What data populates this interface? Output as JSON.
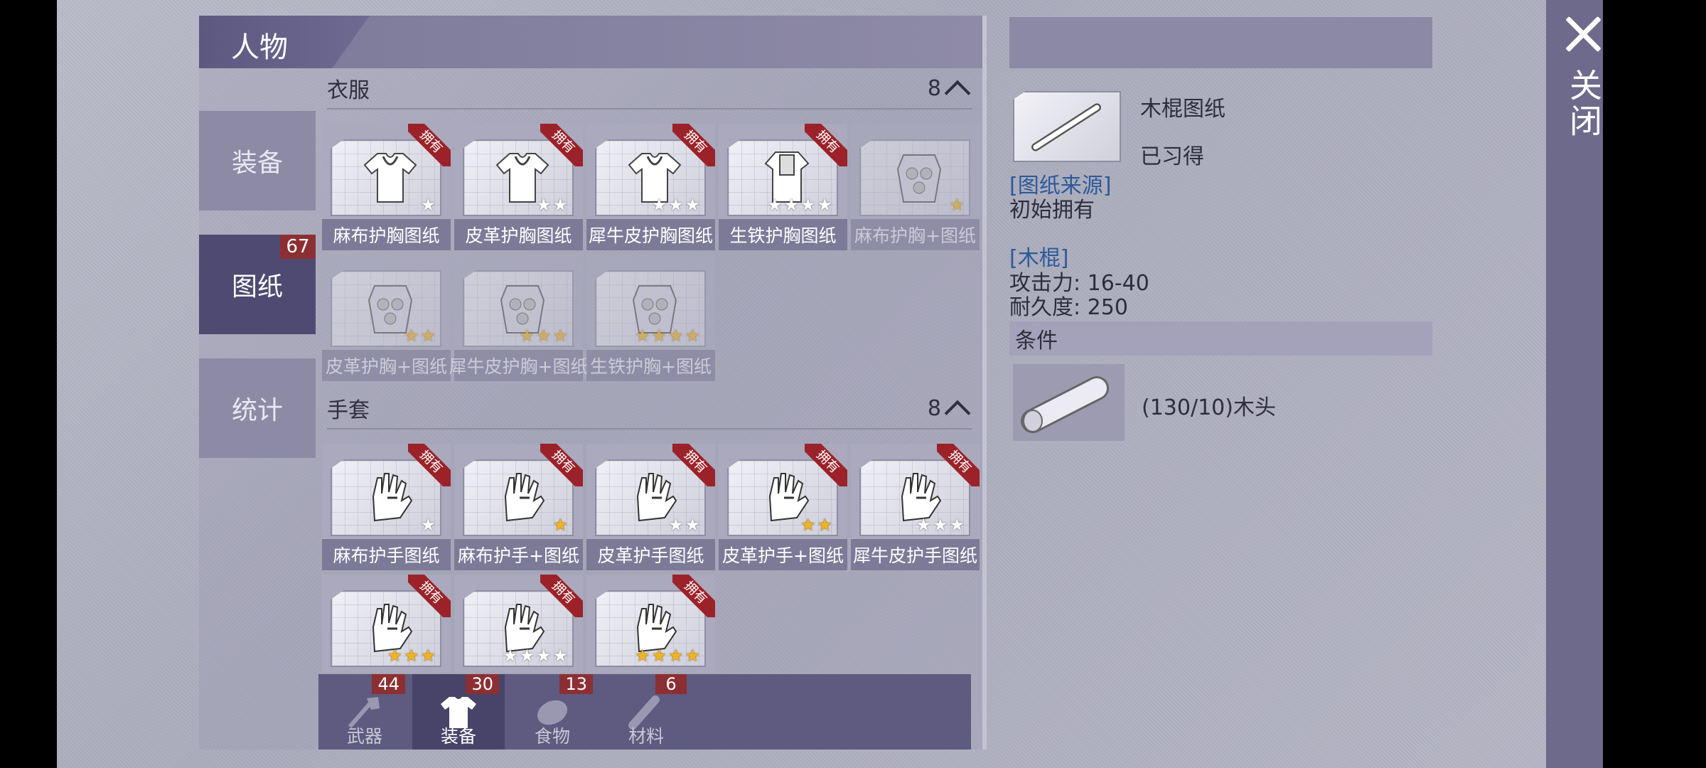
{
  "window": {
    "title": "人物",
    "close_label": "关闭"
  },
  "side_tabs": [
    {
      "label": "装备",
      "badge": ""
    },
    {
      "label": "图纸",
      "badge": "67"
    },
    {
      "label": "统计",
      "badge": ""
    }
  ],
  "sections": [
    {
      "title": "衣服",
      "count": "8",
      "items": [
        {
          "label": "麻布护胸图纸",
          "owned": true,
          "owned_label": "拥有",
          "stars": 1,
          "star_color": "white",
          "icon": "shirt-icon"
        },
        {
          "label": "皮革护胸图纸",
          "owned": true,
          "owned_label": "拥有",
          "stars": 2,
          "star_color": "white",
          "icon": "shirt-icon"
        },
        {
          "label": "犀牛皮护胸图纸",
          "owned": true,
          "owned_label": "拥有",
          "stars": 3,
          "star_color": "white",
          "icon": "shirt-icon"
        },
        {
          "label": "生铁护胸图纸",
          "owned": true,
          "owned_label": "拥有",
          "stars": 4,
          "star_color": "white",
          "icon": "vest-icon"
        },
        {
          "label": "麻布护胸+图纸",
          "owned": false,
          "owned_label": "",
          "stars": 1,
          "star_color": "gold",
          "icon": "armor-icon"
        },
        {
          "label": "皮革护胸+图纸",
          "owned": false,
          "owned_label": "",
          "stars": 2,
          "star_color": "gold",
          "icon": "armor-icon"
        },
        {
          "label": "犀牛皮护胸+图纸",
          "owned": false,
          "owned_label": "",
          "stars": 3,
          "star_color": "gold",
          "icon": "armor-icon"
        },
        {
          "label": "生铁护胸+图纸",
          "owned": false,
          "owned_label": "",
          "stars": 4,
          "star_color": "gold",
          "icon": "armor-icon"
        }
      ]
    },
    {
      "title": "手套",
      "count": "8",
      "items": [
        {
          "label": "麻布护手图纸",
          "owned": true,
          "owned_label": "拥有",
          "stars": 1,
          "star_color": "white",
          "icon": "glove-icon"
        },
        {
          "label": "麻布护手+图纸",
          "owned": true,
          "owned_label": "拥有",
          "stars": 1,
          "star_color": "gold",
          "icon": "glove-icon"
        },
        {
          "label": "皮革护手图纸",
          "owned": true,
          "owned_label": "拥有",
          "stars": 2,
          "star_color": "white",
          "icon": "glove-icon"
        },
        {
          "label": "皮革护手+图纸",
          "owned": true,
          "owned_label": "拥有",
          "stars": 2,
          "star_color": "gold",
          "icon": "glove-icon"
        },
        {
          "label": "犀牛皮护手图纸",
          "owned": true,
          "owned_label": "拥有",
          "stars": 3,
          "star_color": "white",
          "icon": "glove-icon"
        },
        {
          "label": "",
          "owned": true,
          "owned_label": "拥有",
          "stars": 3,
          "star_color": "gold",
          "icon": "glove-icon"
        },
        {
          "label": "",
          "owned": true,
          "owned_label": "拥有",
          "stars": 4,
          "star_color": "white",
          "icon": "glove-icon"
        },
        {
          "label": "",
          "owned": true,
          "owned_label": "拥有",
          "stars": 4,
          "star_color": "gold",
          "icon": "glove-icon"
        }
      ]
    }
  ],
  "bottom_tabs": [
    {
      "label": "武器",
      "badge": "44",
      "icon": "axe-icon"
    },
    {
      "label": "装备",
      "badge": "30",
      "icon": "shirt-icon"
    },
    {
      "label": "食物",
      "badge": "13",
      "icon": "food-icon"
    },
    {
      "label": "材料",
      "badge": "6",
      "icon": "wood-icon"
    }
  ],
  "detail": {
    "name": "木棍图纸",
    "status": "已习得",
    "source_heading": "[图纸来源]",
    "source_text": "初始拥有",
    "item_heading": "[木棍]",
    "attack_label": "攻击力: 16-40",
    "durability_label": "耐久度: 250",
    "conditions_heading": "条件",
    "condition_text": "(130/10)木头"
  }
}
